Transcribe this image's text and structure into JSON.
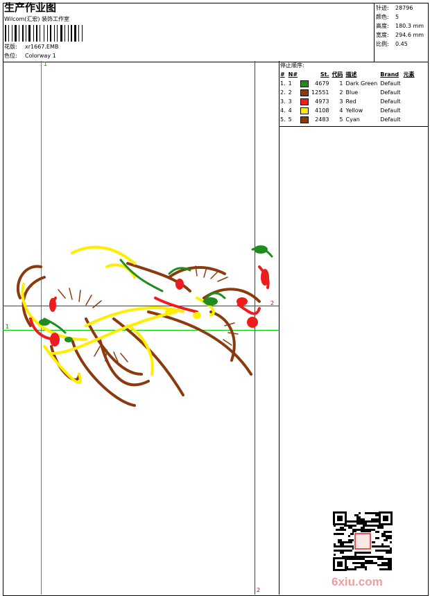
{
  "header": {
    "title": "生产作业图",
    "company": "Wilcom(汇宏) 装饰工作室",
    "design_label": "花版:",
    "design_value": "xr1667.EMB",
    "colorway_label": "色位:",
    "colorway_value": "Colorway 1"
  },
  "stats": [
    {
      "label": "针迹:",
      "value": "28796"
    },
    {
      "label": "颜色:",
      "value": "5"
    },
    {
      "label": "高度:",
      "value": "180.3 mm"
    },
    {
      "label": "宽度:",
      "value": "294.6 mm"
    },
    {
      "label": "比例:",
      "value": "0.45"
    }
  ],
  "stop_sequence": {
    "title": "停止顺序:",
    "columns": [
      "#",
      "N#",
      "St.",
      "代码",
      "描述",
      "Brand",
      "元素"
    ],
    "rows": [
      {
        "n": "1.",
        "needle": "1",
        "color": "#1e8c1e",
        "stitches": "4679",
        "code": "1",
        "desc": "Dark Green",
        "brand": "Default"
      },
      {
        "n": "2.",
        "needle": "2",
        "color": "#8b3a0f",
        "stitches": "12551",
        "code": "2",
        "desc": "Blue",
        "brand": "Default"
      },
      {
        "n": "3.",
        "needle": "3",
        "color": "#ee1c1c",
        "stitches": "4973",
        "code": "3",
        "desc": "Red",
        "brand": "Default"
      },
      {
        "n": "4.",
        "needle": "4",
        "color": "#ffee00",
        "stitches": "4108",
        "code": "4",
        "desc": "Yellow",
        "brand": "Default"
      },
      {
        "n": "5.",
        "needle": "5",
        "color": "#8b3a0f",
        "stitches": "2483",
        "code": "5",
        "desc": "Cyan",
        "brand": "Default"
      }
    ]
  },
  "guides": {
    "green_label_top": "1",
    "green_label_left": "1",
    "red_label_right": "2",
    "red_label_bottom": "2"
  },
  "watermark": "6xiu.com",
  "colors": {
    "green_guide": "#00cc00",
    "red_guide": "#dd0000",
    "brown": "#8b3a0f",
    "green": "#1e8c1e",
    "red": "#ee1c1c",
    "yellow": "#ffee00"
  }
}
